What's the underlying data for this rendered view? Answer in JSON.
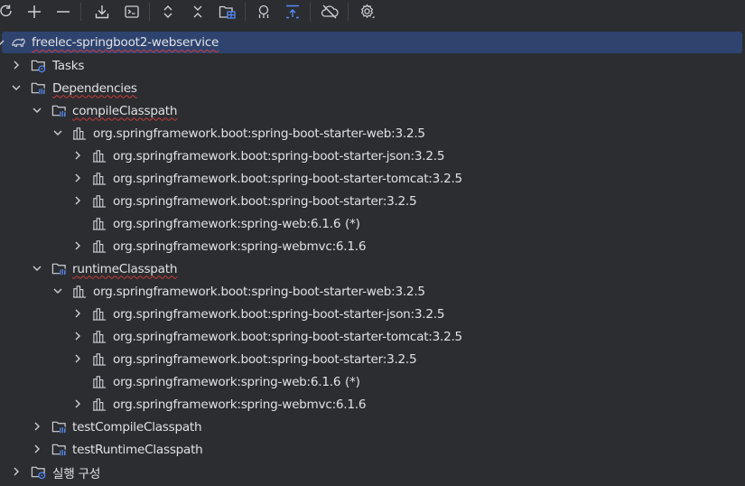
{
  "toolbar": {
    "buttons": [
      {
        "icon": "refresh-icon"
      },
      {
        "icon": "add-icon"
      },
      {
        "icon": "remove-icon"
      },
      {
        "icon": "download-sources-icon"
      },
      {
        "icon": "run-task-icon"
      },
      {
        "icon": "expand-all-icon"
      },
      {
        "icon": "collapse-all-icon"
      },
      {
        "icon": "project-structure-icon"
      },
      {
        "icon": "analyze-dependencies-icon"
      },
      {
        "icon": "toggle-offline-icon"
      },
      {
        "icon": "offline-mode-icon"
      },
      {
        "icon": "settings-icon"
      }
    ]
  },
  "tree": {
    "root": {
      "label": "freelec-springboot2-webservice"
    },
    "tasks": {
      "label": "Tasks"
    },
    "dependencies": {
      "label": "Dependencies"
    },
    "compile": {
      "label": "compileClasspath",
      "web": "org.springframework.boot:spring-boot-starter-web:3.2.5",
      "json": "org.springframework.boot:spring-boot-starter-json:3.2.5",
      "tomcat": "org.springframework.boot:spring-boot-starter-tomcat:3.2.5",
      "starter": "org.springframework.boot:spring-boot-starter:3.2.5",
      "springweb": "org.springframework:spring-web:6.1.6",
      "springweb_mark": "(*)",
      "webmvc": "org.springframework:spring-webmvc:6.1.6"
    },
    "runtime": {
      "label": "runtimeClasspath",
      "web": "org.springframework.boot:spring-boot-starter-web:3.2.5",
      "json": "org.springframework.boot:spring-boot-starter-json:3.2.5",
      "tomcat": "org.springframework.boot:spring-boot-starter-tomcat:3.2.5",
      "starter": "org.springframework.boot:spring-boot-starter:3.2.5",
      "springweb": "org.springframework:spring-web:6.1.6",
      "springweb_mark": "(*)",
      "webmvc": "org.springframework:spring-webmvc:6.1.6"
    },
    "testCompile": {
      "label": "testCompileClasspath"
    },
    "testRuntime": {
      "label": "testRuntimeClasspath"
    },
    "runConfigs": {
      "label": "실행 구성"
    }
  },
  "colors": {
    "background": "#2b2d30",
    "selection": "#2e436e",
    "selection_border": "#3574f0",
    "text": "#dfe1e5",
    "icon": "#ced0d6",
    "accent_blue": "#548af7",
    "squiggle": "#cc3b3b"
  }
}
